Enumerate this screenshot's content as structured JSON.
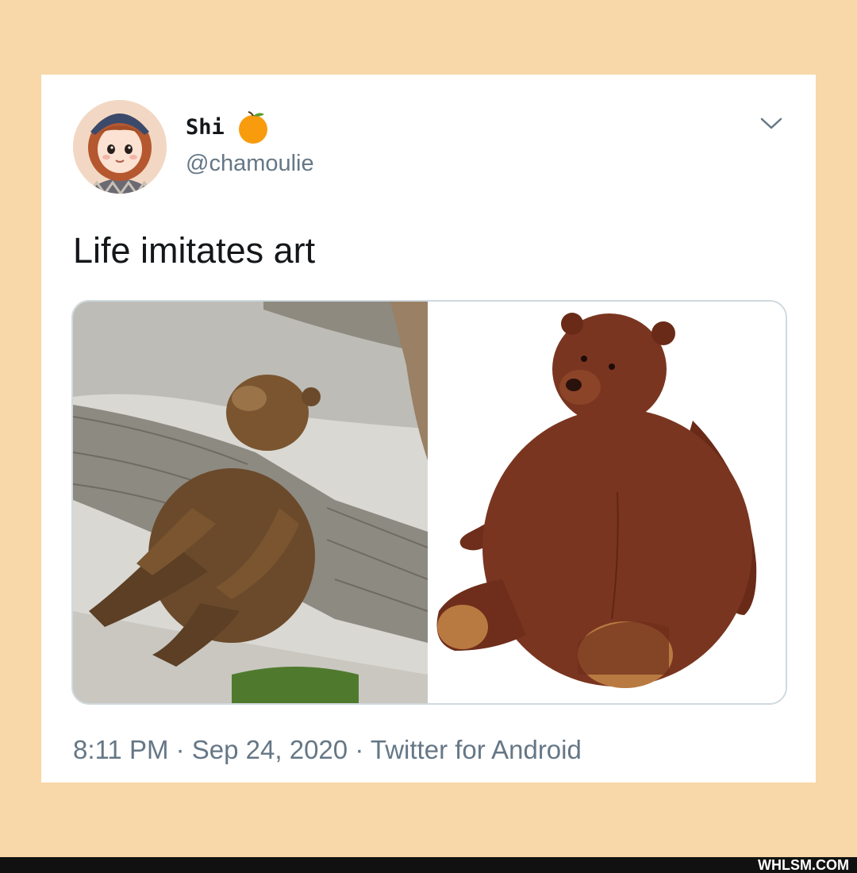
{
  "tweet": {
    "display_name": "Shi",
    "handle": "@chamoulie",
    "text": "Life imitates art",
    "timestamp": "8:11 PM",
    "date": "Sep 24, 2020",
    "source": "Twitter for Android",
    "separator": "·",
    "media": [
      {
        "description": "brown-bear-lounging-photo"
      },
      {
        "description": "brown-teddy-bear-plush-photo"
      }
    ]
  },
  "watermark": "WHLSM.COM",
  "colors": {
    "page_background": "#f8d7a8",
    "card_background": "#ffffff",
    "primary_text": "#14171a",
    "secondary_text": "#657786",
    "media_border": "#cfd9de"
  },
  "icons": {
    "verified_emoji": "orange-emoji-icon",
    "menu": "chevron-down-icon"
  }
}
